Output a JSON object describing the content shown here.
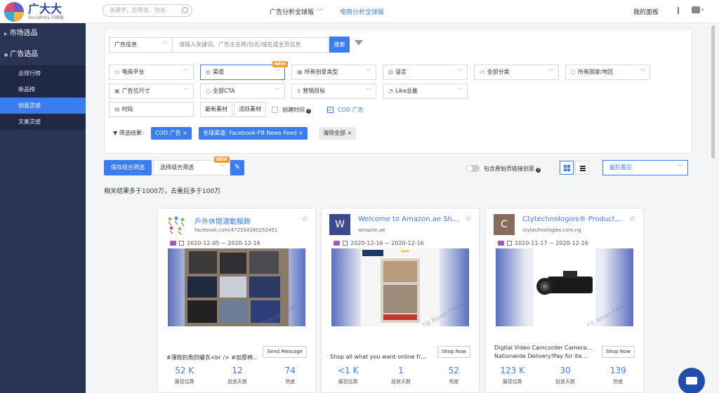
{
  "header": {
    "logo_title": "广大大",
    "logo_sub": "SocialPeta 中国版",
    "search_placeholder": "关键字、应用名、包名",
    "nav_ad": "广告分析全球版",
    "nav_ad_chevron": "﹀",
    "nav_ecom": "电商分析全球版",
    "my_panel": "我的面板"
  },
  "sidebar": {
    "groups": [
      {
        "label": "市场选品"
      },
      {
        "label": "广告选品"
      }
    ],
    "items": [
      {
        "label": "总排行榜"
      },
      {
        "label": "新品榜"
      },
      {
        "label": "创意灵感"
      },
      {
        "label": "文案灵感"
      }
    ]
  },
  "filters": {
    "ad_info_select": "广告信息",
    "keyword_placeholder": "请输入关键词、广告主名称/包名/域名或主页信息",
    "search_btn": "搜索",
    "new_badge": "NEW",
    "row1": [
      "电商平台",
      "渠道",
      "所有创意类型",
      "语言",
      "全部分类",
      "所有国家/地区"
    ],
    "row2": [
      "广告位尺寸",
      "全部CTA",
      "营销目标",
      "Like总量"
    ],
    "time_range": "时段",
    "latest_btn": "最新素材",
    "active_btn": "活跃素材",
    "create_time_label": "创建时间",
    "cod_label": "COD 广告",
    "result_label": "筛选结果:",
    "tags": [
      "COD 广告 ×",
      "全球渠道: Facebook-FB News Feed ×",
      "清除全部 ×"
    ]
  },
  "toolbar": {
    "save_btn": "保存组合筛选",
    "combo_placeholder": "选择组合筛选",
    "include_label": "包含原始页链接创意",
    "sort": "最后看见"
  },
  "result_summary": "相关结果多于1000万，去重后多于100万",
  "cards": [
    {
      "title": "戶外休閒運動服飾",
      "sub": "facebook.com/472354180252451",
      "date": "2020-12-05 ~ 2020-12-16",
      "desc": "#薄款釣魚防曬衣<br /> #加厚棉...",
      "cta": "Send Message",
      "stats": [
        {
          "value": "52 K",
          "label": "展现估算"
        },
        {
          "value": "12",
          "label": "投放天数"
        },
        {
          "value": "74",
          "label": "热度"
        }
      ]
    },
    {
      "avatar": "W",
      "title": "Welcome to Amazon.ae Sh...",
      "sub": "amazon.ae",
      "date": "2020-12-16 ~ 2020-12-16",
      "desc": "Shop all what you want online from ...",
      "cta": "Shop Now",
      "watermark": "FB News Feed",
      "stats": [
        {
          "value": "<1 K",
          "label": "展现估算"
        },
        {
          "value": "1",
          "label": "投放天数"
        },
        {
          "value": "52",
          "label": "热度"
        }
      ]
    },
    {
      "avatar": "C",
      "title": "Ctytechnologies® Product...",
      "sub": "ctytechnologies.com.ng",
      "date": "2020-11-17 ~ 2020-12-16",
      "desc_line1": "Digital Video Camcorder Camera 30...",
      "desc_line2": "Nationwide Delivery!Pay for item O...",
      "cta": "Shop Now",
      "watermark": "FB News Feed",
      "stats": [
        {
          "value": "123 K",
          "label": "展现估算"
        },
        {
          "value": "30",
          "label": "投放天数"
        },
        {
          "value": "139",
          "label": "热度"
        }
      ]
    }
  ],
  "colors": {
    "accent": "#3b7cf0",
    "sidebar": "#2a3556"
  }
}
